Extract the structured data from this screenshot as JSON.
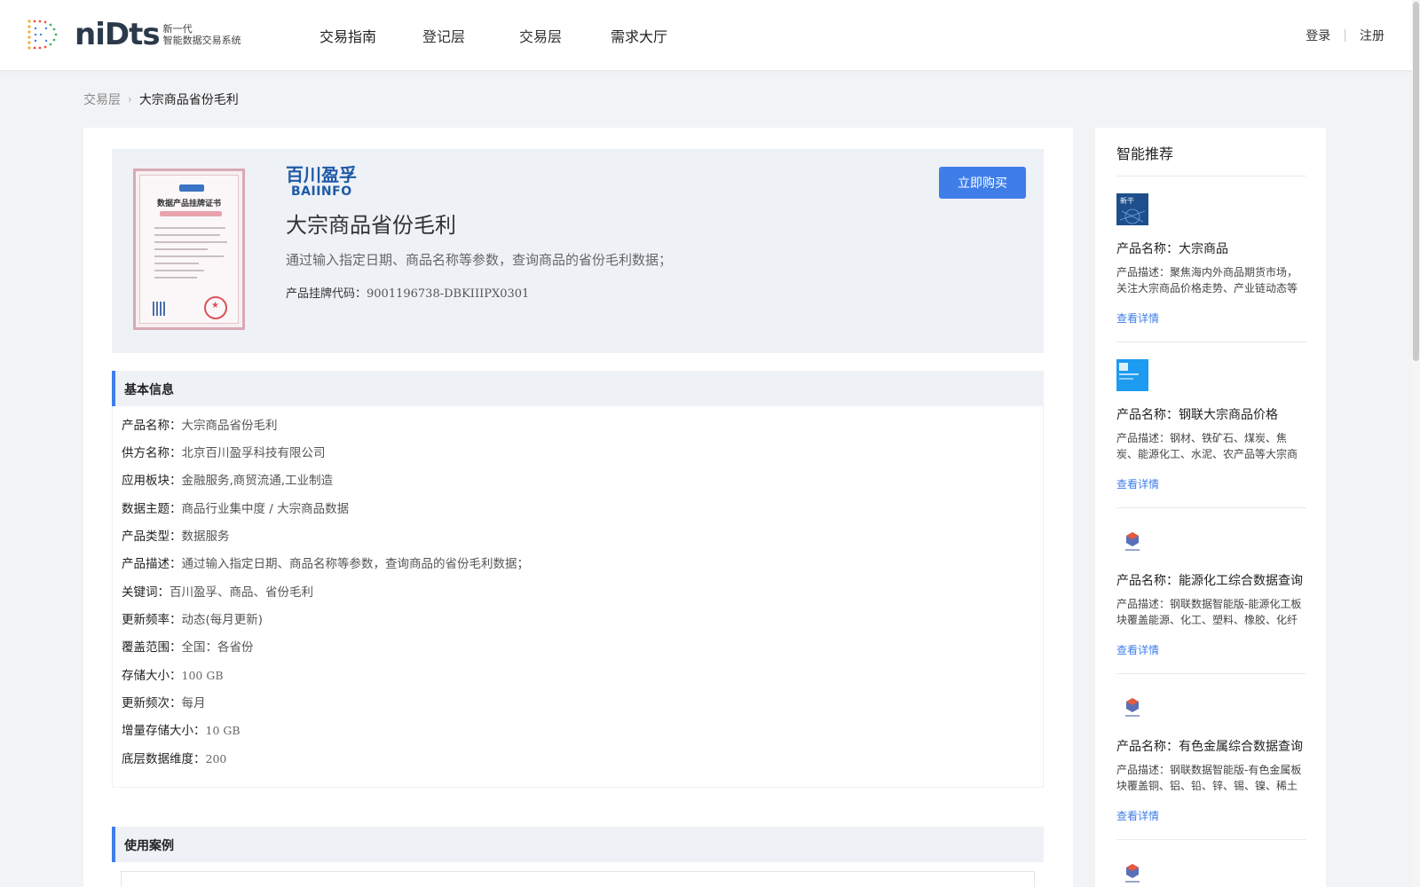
{
  "header": {
    "logo_word": "niDts",
    "logo_sub_1": "新一代",
    "logo_sub_2": "智能数据交易系统",
    "nav": [
      "交易指南",
      "登记层",
      "交易层",
      "需求大厅"
    ],
    "login": "登录",
    "register": "注册",
    "divider": "|"
  },
  "breadcrumb": {
    "parent": "交易层",
    "separator": "›",
    "current": "大宗商品省份毛利"
  },
  "product": {
    "brand_cn": "百川盈孚",
    "brand_en": "BAIINFO",
    "title": "大宗商品省份毛利",
    "description": "通过输入指定日期、商品名称等参数，查询商品的省份毛利数据；",
    "code_label": "产品挂牌代码：",
    "code_value": "9001196738-DBKIIIPX0301",
    "buy_label": "立即购买",
    "certificate_title": "数据产品挂牌证书"
  },
  "basic_info": {
    "title": "基本信息",
    "rows": [
      {
        "k": "产品名称：",
        "v": "大宗商品省份毛利"
      },
      {
        "k": "供方名称：",
        "v": "北京百川盈孚科技有限公司"
      },
      {
        "k": "应用板块：",
        "v": "金融服务,商贸流通,工业制造"
      },
      {
        "k": "数据主题：",
        "v": "商品行业集中度 / 大宗商品数据"
      },
      {
        "k": "产品类型：",
        "v": "数据服务"
      },
      {
        "k": "产品描述：",
        "v": "通过输入指定日期、商品名称等参数，查询商品的省份毛利数据；"
      },
      {
        "k": "关键词：",
        "v": "百川盈孚、商品、省份毛利"
      },
      {
        "k": "更新频率：",
        "v": "动态(每月更新)"
      },
      {
        "k": "覆盖范围：",
        "v": "全国：各省份"
      },
      {
        "k": "存储大小：",
        "v": "100 GB"
      },
      {
        "k": "更新频次：",
        "v": "每月"
      },
      {
        "k": "增量存储大小：",
        "v": "10 GB"
      },
      {
        "k": "底层数据维度：",
        "v": "200"
      }
    ]
  },
  "cases": {
    "title": "使用案例"
  },
  "sidebar": {
    "title": "智能推荐",
    "items": [
      {
        "name": "产品名称：大宗商品",
        "desc": "产品描述：聚焦海内外商品期货市场，关注大宗商品价格走势、产业链动态等相关信息",
        "link": "查看详情",
        "thumb_color": "#1e4f8c"
      },
      {
        "name": "产品名称：钢联大宗商品价格",
        "desc": "产品描述：钢材、铁矿石、煤炭、焦炭、能源化工、水泥、农产品等大宗商品价格数据",
        "link": "查看详情",
        "thumb_color": "#1d9bf0"
      },
      {
        "name": "产品名称：能源化工综合数据查询",
        "desc": "产品描述：钢联数据智能版-能源化工板块覆盖能源、化工、塑料、橡胶、化纤等品种",
        "link": "查看详情",
        "thumb_color": "#e8eef8"
      },
      {
        "name": "产品名称：有色金属综合数据查询",
        "desc": "产品描述：钢联数据智能版-有色金属板块覆盖铜、铝、铅、锌、锡、镍、稀土等品种",
        "link": "查看详情",
        "thumb_color": "#e8eef8"
      }
    ]
  },
  "colors": {
    "accent": "#3f7ee9",
    "brand": "#1f5aa6",
    "card_bg": "#eef1f6",
    "page_bg": "#f2f3f5"
  }
}
